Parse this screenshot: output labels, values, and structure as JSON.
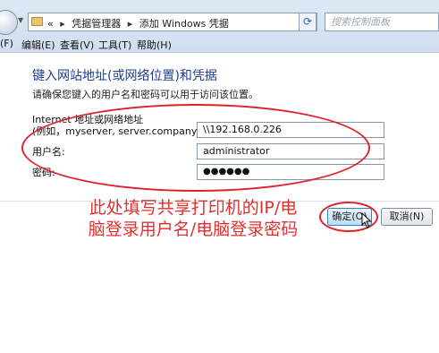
{
  "addressbar": {
    "chevron": "«",
    "crumb1": "凭据管理器",
    "crumb2": "添加 Windows 凭据",
    "search_placeholder": "搜索控制面板"
  },
  "menu": {
    "file": "(F)",
    "edit": "编辑(E)",
    "view": "查看(V)",
    "tools": "工具(T)",
    "help": "帮助(H)"
  },
  "content": {
    "heading": "键入网站地址(或网络位置)和凭据",
    "subtext": "请确保您键入的用户名和密码可以用于访问该位置。"
  },
  "form": {
    "address_label_line1": "Internet 地址或网络地址",
    "address_label_line2": "(例如，myserver, server.company.com):",
    "address_value": "\\\\192.168.0.226",
    "username_label": "用户名:",
    "username_value": "administrator",
    "password_label": "密码:",
    "password_value": "●●●●●●"
  },
  "buttons": {
    "ok": "确定(O)",
    "cancel": "取消(N)"
  },
  "annotation": "此处填写共享打印机的IP/电脑登录用户名/电脑登录密码",
  "colors": {
    "annotation": "#e03030",
    "heading": "#1e3d8f"
  }
}
